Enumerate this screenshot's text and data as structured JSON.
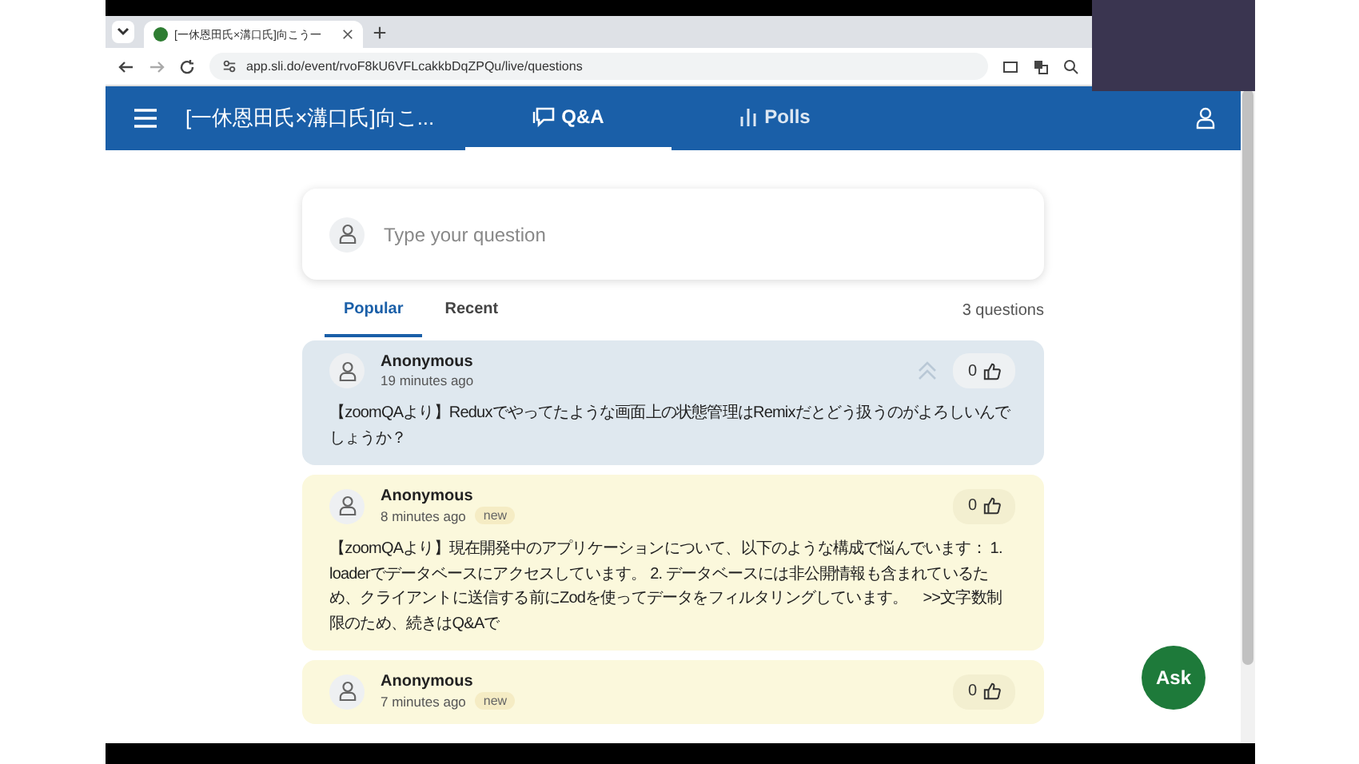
{
  "browser": {
    "tab_title": "[一休恩田氏×溝口氏]向こう一",
    "url": "app.sli.do/event/rvoF8kU6VFLcakkbDqZPQu/live/questions"
  },
  "header": {
    "event_title": "[一休恩田氏×溝口氏]向こ...",
    "nav": [
      {
        "label": "Q&A",
        "selected": true
      },
      {
        "label": "Polls",
        "selected": false
      }
    ]
  },
  "composer": {
    "placeholder": "Type your question"
  },
  "sort_tabs": [
    {
      "label": "Popular",
      "selected": true
    },
    {
      "label": "Recent",
      "selected": false
    }
  ],
  "question_count": "3 questions",
  "questions": [
    {
      "author": "Anonymous",
      "time": "19 minutes ago",
      "new": false,
      "votes": "0",
      "text": "【zoomQAより】Reduxでやってたような画面上の状態管理はRemixだとどう扱うのがよろしいんでしょうか？"
    },
    {
      "author": "Anonymous",
      "time": "8 minutes ago",
      "new": true,
      "badge": "new",
      "votes": "0",
      "text": "【zoomQAより】現在開発中のアプリケーションについて、以下のような構成で悩んでいます： 1. loaderでデータベースにアクセスしています。 2. データベースには非公開情報も含まれているため、クライアントに送信する前にZodを使ってデータをフィルタリングしています。　>>文字数制限のため、続きはQ&Aで"
    },
    {
      "author": "Anonymous",
      "time": "7 minutes ago",
      "new": true,
      "badge": "new",
      "votes": "0"
    }
  ],
  "ask_button": "Ask"
}
